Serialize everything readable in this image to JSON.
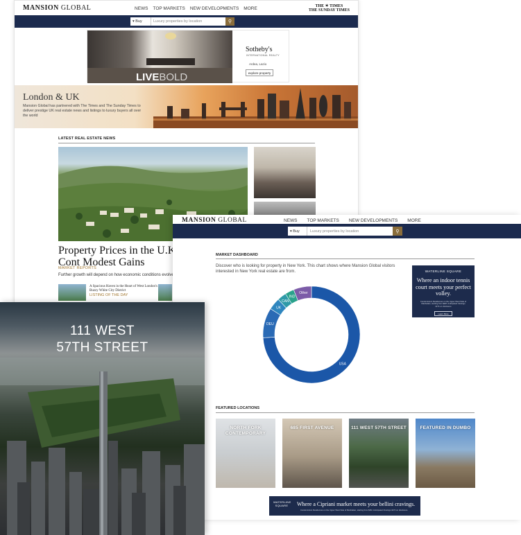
{
  "page1": {
    "logo": {
      "bold": "MANSION",
      "rest": " GLOBAL"
    },
    "nav": [
      "NEWS",
      "TOP MARKETS",
      "NEW DEVELOPMENTS",
      "MORE"
    ],
    "partner_logo": {
      "line1": "THE ✶ TIMES",
      "line2": "THE SUNDAY TIMES"
    },
    "search": {
      "buy_label": "Buy",
      "placeholder": "Luxury properties by location"
    },
    "ad": {
      "tagline_bold": "LIVE",
      "tagline_rest": "BOLD",
      "brand": "Sotheby's",
      "brand_sub": "INTERNATIONAL REALTY",
      "location": "Ardea, Lazio",
      "button": "explore property"
    },
    "hero": {
      "title": "London & UK",
      "text": "Mansion Global has partnered with The Times and The Sunday Times to deliver prestige UK real estate news and listings to luxury buyers all over the world"
    },
    "section_title": "LATEST REAL ESTATE NEWS",
    "headline": "Property Prices in the U.K. Cont Modest Gains",
    "category": "MARKET REPORTS",
    "description": "Further growth will depend on how economic conditions evolve",
    "listing": {
      "title": "A Spacious Haven in the Heart of West London's Buzzy White City District",
      "category": "LISTING OF THE DAY"
    }
  },
  "page2": {
    "logo": {
      "bold": "MANSION",
      "rest": " GLOBAL"
    },
    "nav": [
      "NEWS",
      "TOP MARKETS",
      "NEW DEVELOPMENTS",
      "MORE"
    ],
    "search": {
      "buy_label": "Buy",
      "placeholder": "Luxury properties by location"
    },
    "section_title": "MARKET DASHBOARD",
    "intro": "Discover who is looking for property in New York. This chart shows where Mansion Global visitors interested in New York real estate are from.",
    "ad": {
      "brand": "WATERLINE SQUARE",
      "headline": "Where an indoor tennis court meets your perfect volley.",
      "fine": "Condominium Residences on the Upper West Side of Manhattan, starting from $2M. Anticipated Closings 4274 on disclosure",
      "button": "Learn More"
    },
    "featured_title": "FEATURED LOCATIONS",
    "featured": [
      {
        "label": "NORTH FORK CONTEMPORARY"
      },
      {
        "label": "685 FIRST AVENUE"
      },
      {
        "label": "111 WEST 57TH STREET"
      },
      {
        "label": "FEATURED IN DUMBO"
      }
    ],
    "banner": {
      "brand": "WATERLINE SQUARE",
      "headline": "Where a Cipriani market meets your bellini cravings.",
      "fine": "Condominium Residences on the Upper West Side of Manhattan, starting from $2M. Anticipated Closings 4274 on disclosure"
    }
  },
  "page3": {
    "title_line1": "111 WEST",
    "title_line2": "57TH STREET"
  },
  "chart_data": {
    "type": "pie",
    "donut": true,
    "categories": [
      "USA",
      "DEU",
      "UK",
      "CAN",
      "IND",
      "Other"
    ],
    "values": [
      74,
      10,
      4,
      3,
      3,
      6
    ],
    "colors": [
      "#1b57a8",
      "#2a6ab5",
      "#2f86bf",
      "#2f9aa8",
      "#2aa28c",
      "#7c5ca8"
    ]
  },
  "colors": {
    "navy": "#1b2a4e",
    "gold": "#a0752d",
    "search_button": "#8a6d3b"
  }
}
